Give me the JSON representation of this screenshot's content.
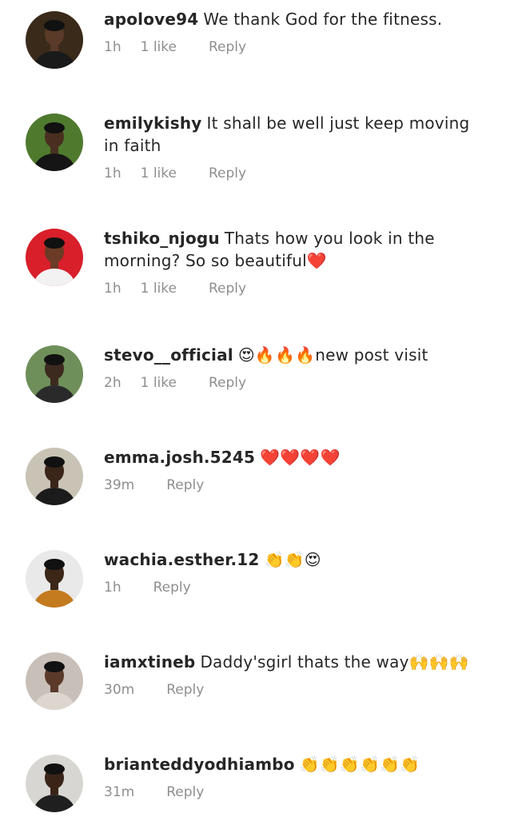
{
  "comments": [
    {
      "username": "apolove94",
      "text": "We thank God for the fitness.",
      "emojis": "",
      "time": "1h",
      "likes": "1 like",
      "reply": "Reply",
      "avatar": {
        "bg": "#3a2a1a",
        "skin": "#5a3a28",
        "cloth": "#1a1a1a"
      }
    },
    {
      "username": "emilykishy",
      "text": "It shall be well just keep moving in faith",
      "emojis": "",
      "time": "1h",
      "likes": "1 like",
      "reply": "Reply",
      "avatar": {
        "bg": "#4f7a2e",
        "skin": "#4a2f20",
        "cloth": "#151515"
      }
    },
    {
      "username": "tshiko_njogu",
      "text": "Thats how you look in the morning? So so beautiful",
      "emojis": "❤️",
      "time": "1h",
      "likes": "1 like",
      "reply": "Reply",
      "avatar": {
        "bg": "#d81f2a",
        "skin": "#6b3b26",
        "cloth": "#f2f2f2"
      }
    },
    {
      "username": "stevo__official",
      "text": "new post visit",
      "emojis": "😍🔥🔥🔥",
      "time": "2h",
      "likes": "1 like",
      "reply": "Reply",
      "avatar": {
        "bg": "#6f8f5a",
        "skin": "#3d2a1e",
        "cloth": "#2a2a2a"
      }
    },
    {
      "username": "emma.josh.5245",
      "text": "",
      "emojis": "❤️❤️❤️❤️",
      "time": "39m",
      "likes": "",
      "reply": "Reply",
      "avatar": {
        "bg": "#c9c3b6",
        "skin": "#3a2519",
        "cloth": "#1b1b1b"
      }
    },
    {
      "username": "wachia.esther.12",
      "text": "",
      "emojis": "👏👏😍",
      "time": "1h",
      "likes": "",
      "reply": "Reply",
      "avatar": {
        "bg": "#e9e9e9",
        "skin": "#3b2618",
        "cloth": "#c47a1e"
      }
    },
    {
      "username": "iamxtineb",
      "text": "Daddy'sgirl thats the way",
      "emojis": "🙌🙌🙌",
      "time": "30m",
      "likes": "",
      "reply": "Reply",
      "avatar": {
        "bg": "#c8bfb8",
        "skin": "#5b3a2a",
        "cloth": "#ddd6cf"
      }
    },
    {
      "username": "brianteddyodhiambo",
      "text": "",
      "emojis": "👏👏👏👏👏👏",
      "time": "31m",
      "likes": "",
      "reply": "Reply",
      "avatar": {
        "bg": "#d8d6d2",
        "skin": "#3a2418",
        "cloth": "#1f1f1f"
      }
    }
  ]
}
